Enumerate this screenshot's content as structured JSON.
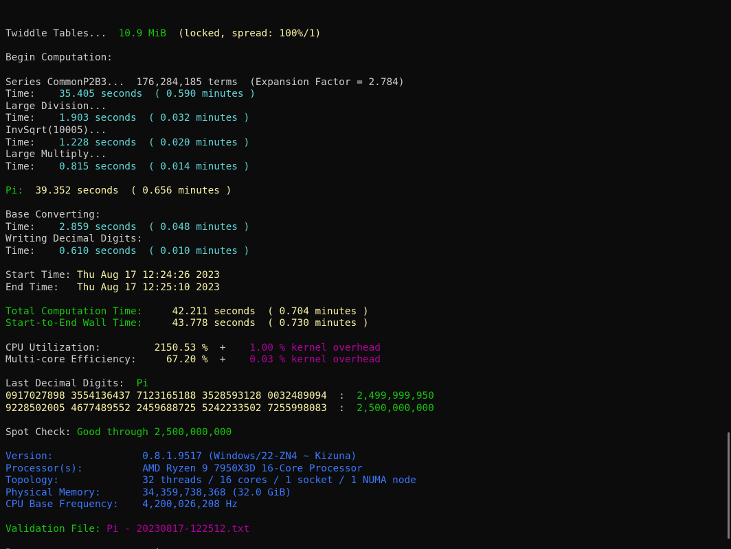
{
  "colors": {
    "background": "#0c0c0c",
    "default_text": "#cccccc",
    "green": "#16c60c",
    "yellow": "#f9f1a5",
    "cyan": "#61d6d6",
    "magenta": "#b4009e",
    "blue": "#3b78ff"
  },
  "lines": [
    [
      {
        "t": "Twiddle Tables...  ",
        "c": "white"
      },
      {
        "t": "10.9 MiB",
        "c": "green"
      },
      {
        "t": "  (locked, spread: 100%/1)",
        "c": "yellow"
      }
    ],
    [],
    [
      {
        "t": "Begin Computation:",
        "c": "white"
      }
    ],
    [],
    [
      {
        "t": "Series CommonP2B3...  176,284,185 terms  (Expansion Factor = 2.784)",
        "c": "white"
      }
    ],
    [
      {
        "t": "Time:    ",
        "c": "white"
      },
      {
        "t": "35.405 seconds  ( 0.590 minutes )",
        "c": "cyan"
      }
    ],
    [
      {
        "t": "Large Division...",
        "c": "white"
      }
    ],
    [
      {
        "t": "Time:    ",
        "c": "white"
      },
      {
        "t": "1.903 seconds  ( 0.032 minutes )",
        "c": "cyan"
      }
    ],
    [
      {
        "t": "InvSqrt(10005)...",
        "c": "white"
      }
    ],
    [
      {
        "t": "Time:    ",
        "c": "white"
      },
      {
        "t": "1.228 seconds  ( 0.020 minutes )",
        "c": "cyan"
      }
    ],
    [
      {
        "t": "Large Multiply...",
        "c": "white"
      }
    ],
    [
      {
        "t": "Time:    ",
        "c": "white"
      },
      {
        "t": "0.815 seconds  ( 0.014 minutes )",
        "c": "cyan"
      }
    ],
    [],
    [
      {
        "t": "Pi:  ",
        "c": "green"
      },
      {
        "t": "39.352 seconds  ( 0.656 minutes )",
        "c": "yellow"
      }
    ],
    [],
    [
      {
        "t": "Base Converting:",
        "c": "white"
      }
    ],
    [
      {
        "t": "Time:    ",
        "c": "white"
      },
      {
        "t": "2.859 seconds  ( 0.048 minutes )",
        "c": "cyan"
      }
    ],
    [
      {
        "t": "Writing Decimal Digits:",
        "c": "white"
      }
    ],
    [
      {
        "t": "Time:    ",
        "c": "white"
      },
      {
        "t": "0.610 seconds  ( 0.010 minutes )",
        "c": "cyan"
      }
    ],
    [],
    [
      {
        "t": "Start Time: ",
        "c": "white"
      },
      {
        "t": "Thu Aug 17 12:24:26 2023",
        "c": "yellow"
      }
    ],
    [
      {
        "t": "End Time:   ",
        "c": "white"
      },
      {
        "t": "Thu Aug 17 12:25:10 2023",
        "c": "yellow"
      }
    ],
    [],
    [
      {
        "t": "Total Computation Time:     ",
        "c": "green"
      },
      {
        "t": "42.211 seconds  ( 0.704 minutes )",
        "c": "yellow"
      }
    ],
    [
      {
        "t": "Start-to-End Wall Time:     ",
        "c": "green"
      },
      {
        "t": "43.778 seconds  ( 0.730 minutes )",
        "c": "yellow"
      }
    ],
    [],
    [
      {
        "t": "CPU Utilization:         ",
        "c": "white"
      },
      {
        "t": "2150.53 %",
        "c": "yellow"
      },
      {
        "t": "  +    ",
        "c": "white"
      },
      {
        "t": "1.00 % kernel overhead",
        "c": "magenta"
      }
    ],
    [
      {
        "t": "Multi-core Efficiency:     ",
        "c": "white"
      },
      {
        "t": "67.20 %",
        "c": "yellow"
      },
      {
        "t": "  +    ",
        "c": "white"
      },
      {
        "t": "0.03 % kernel overhead",
        "c": "magenta"
      }
    ],
    [],
    [
      {
        "t": "Last Decimal Digits:  ",
        "c": "white"
      },
      {
        "t": "Pi",
        "c": "green"
      }
    ],
    [
      {
        "t": "0917027898 3554136437 7123165188 3528593128 0032489094",
        "c": "yellow"
      },
      {
        "t": "  :  ",
        "c": "white"
      },
      {
        "t": "2,499,999,950",
        "c": "green"
      }
    ],
    [
      {
        "t": "9228502005 4677489552 2459688725 5242233502 7255998083",
        "c": "yellow"
      },
      {
        "t": "  :  ",
        "c": "white"
      },
      {
        "t": "2,500,000,000",
        "c": "green"
      }
    ],
    [],
    [
      {
        "t": "Spot Check: ",
        "c": "white"
      },
      {
        "t": "Good through 2,500,000,000",
        "c": "green"
      }
    ],
    [],
    [
      {
        "t": "Version:               0.8.1.9517 (Windows/22-ZN4 ~ Kizuna)",
        "c": "blue"
      }
    ],
    [
      {
        "t": "Processor(s):          AMD Ryzen 9 7950X3D 16-Core Processor",
        "c": "blue"
      }
    ],
    [
      {
        "t": "Topology:              32 threads / 16 cores / 1 socket / 1 NUMA node",
        "c": "blue"
      }
    ],
    [
      {
        "t": "Physical Memory:       34,359,738,368 (32.0 GiB)",
        "c": "blue"
      }
    ],
    [
      {
        "t": "CPU Base Frequency:    4,200,026,208 Hz",
        "c": "blue"
      }
    ],
    [],
    [
      {
        "t": "Validation File: ",
        "c": "green"
      },
      {
        "t": "Pi - 20230817-122512.txt",
        "c": "magenta"
      }
    ],
    [],
    [
      {
        "t": "Premere un tasto per continuare . . .",
        "c": "white"
      }
    ]
  ]
}
